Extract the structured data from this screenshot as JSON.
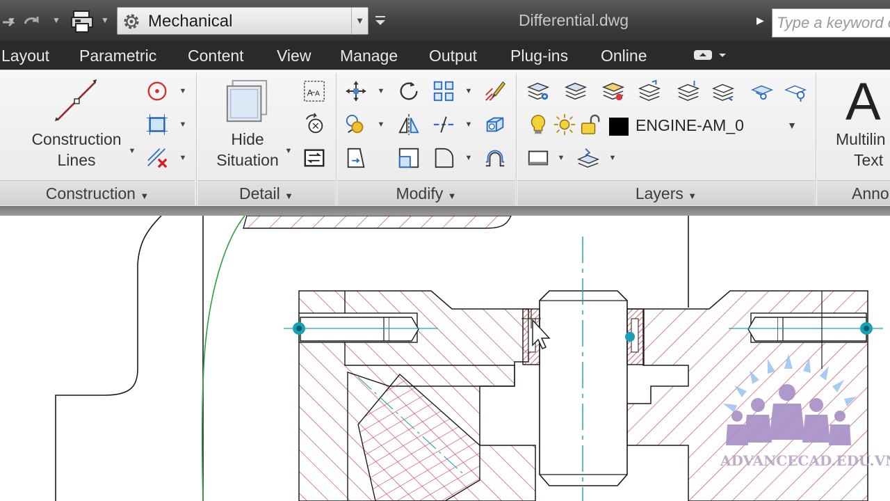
{
  "quick_access": {
    "redo_icon": "redo-arrow-icon",
    "plot_icon": "plot-icon",
    "workspace": "Mechanical",
    "document_title": "Differential.dwg",
    "search_placeholder": "Type a keyword or phrase"
  },
  "tabs": [
    "Layout",
    "Parametric",
    "Content",
    "View",
    "Manage",
    "Output",
    "Plug-ins",
    "Online"
  ],
  "panels": {
    "construction": {
      "title": "Construction",
      "button_line1": "Construction",
      "button_line2": "Lines"
    },
    "detail": {
      "title": "Detail",
      "button_line1": "Hide",
      "button_line2": "Situation"
    },
    "modify": {
      "title": "Modify"
    },
    "layers": {
      "title": "Layers",
      "current_layer": "ENGINE-AM_0",
      "layer_color": "#000000"
    },
    "annotation": {
      "title": "Anno",
      "button_line1": "Multilin",
      "button_line2": "Text",
      "big_icon": "A"
    }
  },
  "drawing": {
    "outline_color": "#1a1a1a",
    "hatch_color": "#d23a4a",
    "centerline_color": "#1aa0b4",
    "construction_color": "#2aa040",
    "highlight_color": "#e2475a"
  },
  "watermark": {
    "text": "ADVANCECAD.EDU.VN"
  }
}
